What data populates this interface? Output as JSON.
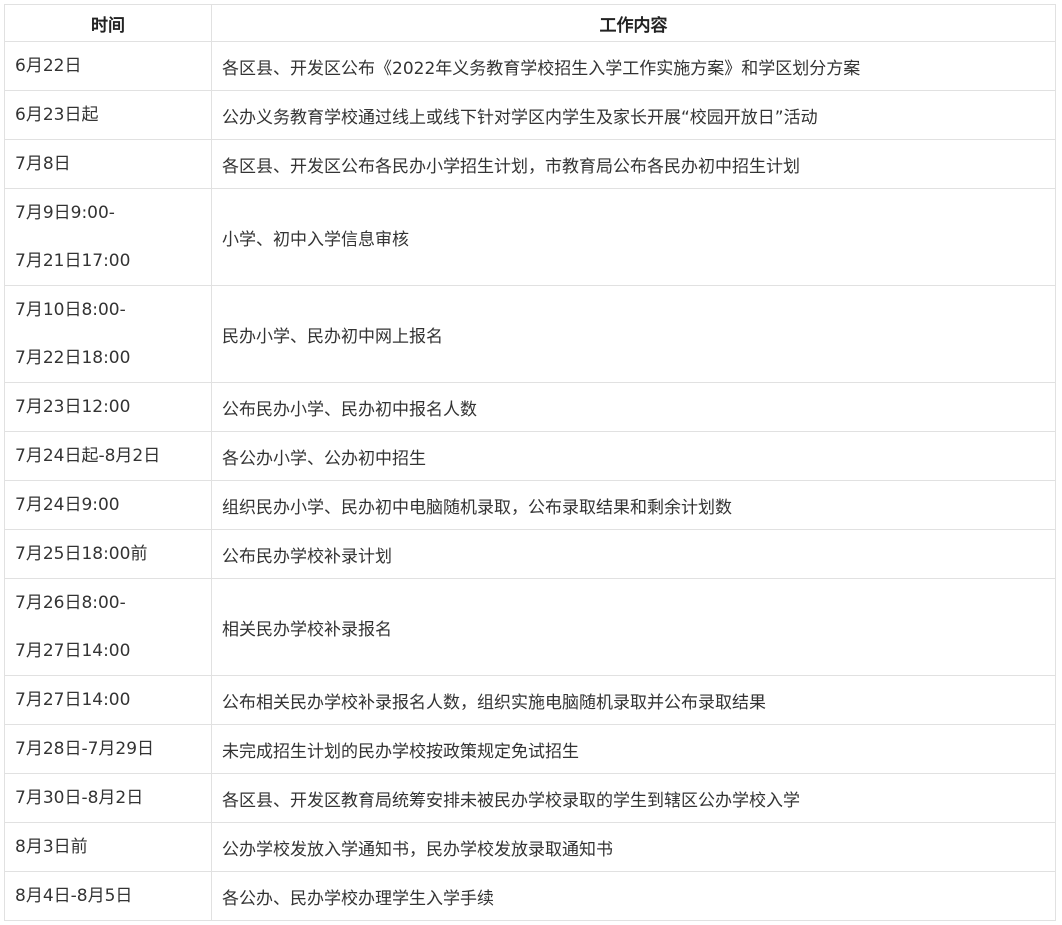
{
  "header": {
    "time": "时间",
    "work": "工作内容"
  },
  "rows": [
    {
      "time": [
        "6月22日"
      ],
      "work": "各区县、开发区公布《2022年义务教育学校招生入学工作实施方案》和学区划分方案"
    },
    {
      "time": [
        "6月23日起"
      ],
      "work": "公办义务教育学校通过线上或线下针对学区内学生及家长开展“校园开放日”活动"
    },
    {
      "time": [
        "7月8日"
      ],
      "work": "各区县、开发区公布各民办小学招生计划，市教育局公布各民办初中招生计划"
    },
    {
      "time": [
        "7月9日9:00-",
        "7月21日17:00"
      ],
      "work": "小学、初中入学信息审核"
    },
    {
      "time": [
        "7月10日8:00-",
        "7月22日18:00"
      ],
      "work": "民办小学、民办初中网上报名"
    },
    {
      "time": [
        "7月23日12:00"
      ],
      "work": "公布民办小学、民办初中报名人数"
    },
    {
      "time": [
        "7月24日起-8月2日"
      ],
      "work": "各公办小学、公办初中招生"
    },
    {
      "time": [
        "7月24日9:00"
      ],
      "work": "组织民办小学、民办初中电脑随机录取，公布录取结果和剩余计划数"
    },
    {
      "time": [
        "7月25日18:00前"
      ],
      "work": "公布民办学校补录计划"
    },
    {
      "time": [
        "7月26日8:00-",
        "7月27日14:00"
      ],
      "work": "相关民办学校补录报名"
    },
    {
      "time": [
        "7月27日14:00"
      ],
      "work": "公布相关民办学校补录报名人数，组织实施电脑随机录取并公布录取结果"
    },
    {
      "time": [
        "7月28日-7月29日"
      ],
      "work": "未完成招生计划的民办学校按政策规定免试招生"
    },
    {
      "time": [
        "7月30日-8月2日"
      ],
      "work": "各区县、开发区教育局统筹安排未被民办学校录取的学生到辖区公办学校入学"
    },
    {
      "time": [
        "8月3日前"
      ],
      "work": "公办学校发放入学通知书，民办学校发放录取通知书"
    },
    {
      "time": [
        "8月4日-8月5日"
      ],
      "work": "各公办、民办学校办理学生入学手续"
    }
  ]
}
